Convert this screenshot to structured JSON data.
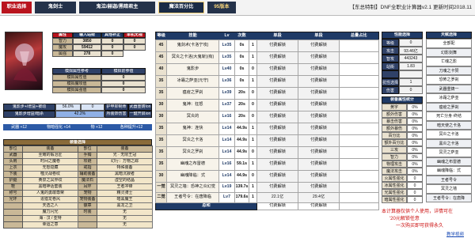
{
  "topbar": {
    "tabs": [
      "职业选择",
      "鬼剑士",
      "鬼泣/赫迦/黑暗君主",
      "魔法百分比",
      "95版本"
    ],
    "banner": "【东总特制】DNF全职业计算器v2.1 更新时间2018.11"
  },
  "attrs": {
    "headers": [
      "属性",
      "输入站街",
      "其他补正",
      "单机无视"
    ],
    "rows": [
      {
        "name": "智力",
        "val": "3850",
        "other": "0",
        "ignore": "0"
      },
      {
        "name": "魔攻",
        "val": "59412",
        "other": "0",
        "ignore": "0"
      },
      {
        "name": "属强",
        "val": "278",
        "other": "0",
        "ignore": ""
      }
    ]
  },
  "simulate": {
    "rows": [
      {
        "label": "模拟属性参考",
        "value": "模拟前参值"
      },
      {
        "label": "模拟属性值",
        "value": "0"
      },
      {
        "label": "模拟魔攻值",
        "value": "0"
      },
      {
        "label": "模拟属强值",
        "value": "0"
      }
    ]
  },
  "buffs": {
    "row1": {
      "a": "鬼影步+/增益+被动",
      "b": "56.0%",
      "c": "0",
      "d": "护甲抑制命",
      "e": "武器重铸Ion"
    },
    "row2": {
      "a": "鬼影步增益/暗杀",
      "b": "42.2%",
      "d": "所装饰伤害",
      "e": "一鍵开启ion"
    },
    "row3": [
      "武器 +12",
      "物暗强化 +14",
      "物 +12",
      "各种提升+12"
    ]
  },
  "equip": {
    "title": "装备选择",
    "headers": [
      "部位",
      "装备",
      "部位",
      "装备"
    ],
    "rows": [
      [
        "",
        "无畏混战衣",
        "部位",
        "黑洞漫步装备3件"
      ],
      [
        "武器",
        "圣耀的锻冶匠",
        "手镯",
        "光 · 无限王冠"
      ],
      [
        "头肩",
        "时间之魔卷",
        "项链",
        "幻行：万物之踪"
      ],
      [
        "上衣",
        "无怒隐藏",
        "戒指",
        "特殊装备"
      ],
      [
        "下装",
        "噬灵战卷纹",
        "辅助装备",
        "黑暗沉寂者"
      ],
      [
        "护腿",
        "黄泉之冥界纹",
        "魔法石",
        "虚空的结晶"
      ],
      [
        "鞋",
        "黑暗神话套装",
        "耳环",
        "王者冲锋"
      ],
      [
        "称号",
        "人鬼的勇敢尊荣",
        "宠物",
        "精灵骑士"
      ],
      [
        "光环",
        "追猎龙卷风",
        "宠物装备",
        "暗黑魔王"
      ],
      [
        "",
        "天选之人",
        "徽章",
        "黑龙之卫"
      ],
      [
        "",
        "魔力闪光",
        "时装",
        "无"
      ],
      [
        "",
        "海 · 汉 / 亚特",
        "",
        "无"
      ],
      [
        "",
        "幸运之意",
        "",
        "无"
      ]
    ]
  },
  "skills": {
    "headers": [
      "等级",
      "技能",
      "Lv",
      "次数",
      "",
      "单段",
      "单段",
      "总量占比"
    ],
    "rows": [
      {
        "lvl": "45",
        "name": "鬼剑术(卡洛宁攻)",
        "lv": "Lv35",
        "n": "0s",
        "cnt": "1",
        "a": "付费解锁",
        "b": "付费解锁"
      },
      {
        "lvl": "45",
        "name": "冥炎之卡洛(大鬼斩)(有)",
        "lv": "Lv35",
        "n": "0s",
        "cnt": "1",
        "a": "付费解锁",
        "b": "付费解锁"
      },
      {
        "lvl": "40",
        "name": "鬼影步",
        "lv": "Lv40",
        "n": "0s",
        "cnt": "0",
        "a": "付费解锁",
        "b": "付费解锁"
      },
      {
        "lvl": "35",
        "name": "冰霜之萨亚(元守)",
        "lv": "Lv36",
        "n": "0s",
        "cnt": "1",
        "a": "付费解锁",
        "b": "付费解锁"
      },
      {
        "lvl": "35",
        "name": "瘟疫之罗刹",
        "lv": "Lv39",
        "n": "20s",
        "cnt": "0",
        "a": "付费解锁",
        "b": "付费解锁"
      },
      {
        "lvl": "30",
        "name": "鬼神：狂怒",
        "lv": "Lv37",
        "n": "20s",
        "cnt": "0",
        "a": "付费解锁",
        "b": "付费解锁"
      },
      {
        "lvl": "30",
        "name": "冥炎的",
        "lv": "Lv16",
        "n": "20s",
        "cnt": "0",
        "a": "付费解锁",
        "b": "付费解锁"
      },
      {
        "lvl": "35",
        "name": "鬼神：连快",
        "lv": "Lv14",
        "n": "44.9s",
        "cnt": "1",
        "a": "付费解锁",
        "b": "付费解锁"
      },
      {
        "lvl": "35",
        "name": "冥炎之卡洛",
        "lv": "Lv14",
        "n": "44.9s",
        "cnt": "1",
        "a": "付费解锁",
        "b": "付费解锁"
      },
      {
        "lvl": "35",
        "name": "冥炎之罗刹",
        "lv": "Lv14",
        "n": "44.9s",
        "cnt": "0",
        "a": "付费解锁",
        "b": "付费解锁"
      },
      {
        "lvl": "35",
        "name": "幽魂之布雷德",
        "lv": "Lv16",
        "n": "59.1s",
        "cnt": "1",
        "a": "付费解锁",
        "b": "付费解锁"
      },
      {
        "lvl": "30",
        "name": "幽魂降临：式",
        "lv": "Lv14",
        "n": "44.9s",
        "cnt": "0",
        "a": "付费解锁",
        "b": "付费解锁"
      }
    ],
    "special": [
      {
        "lvl": "一觉",
        "name": "冥灵之墙：恐神之炎幻觉",
        "lv": "Lv19",
        "n": "139.7s",
        "cnt": "1",
        "a": "付费解锁",
        "b": "付费解锁"
      },
      {
        "lvl": "二觉",
        "name": "王者号令：在唐降临",
        "lv": "Lv7",
        "n": "179.6s",
        "cnt": "1",
        "a": "22.1亿",
        "b": "29.4亿"
      }
    ],
    "total_label": "总和",
    "total_a": "付费解锁",
    "total_b": "付费解锁"
  },
  "rightStats": {
    "title": "性能选择",
    "rows": [
      {
        "k": "等级",
        "v": "0"
      },
      {
        "k": "攻击",
        "v": "93.46亿"
      },
      {
        "k": "智攻",
        "v": "443243"
      },
      {
        "k": "站街",
        "v": "1.83"
      },
      {
        "k": "",
        "v": ""
      },
      {
        "k": "抗性选择",
        "v": "1"
      },
      {
        "k": "伤害",
        "v": "0"
      }
    ],
    "addTitle": "装备属性统计",
    "addRows": [
      [
        "黄字",
        "0%"
      ],
      [
        "额外伤害",
        "0%"
      ],
      [
        "暴击伤害",
        "0%"
      ],
      [
        "额外暴伤",
        "0%"
      ],
      [
        "百分比",
        "0%"
      ],
      [
        "额外百分比",
        "0%"
      ],
      [
        "三攻",
        "0%"
      ],
      [
        "智力",
        "0%"
      ],
      [
        "物理攻击",
        "0%"
      ],
      [
        "魔法攻击",
        "0%"
      ],
      [
        "火属性强化",
        "0"
      ],
      [
        "冰属性强化",
        "0"
      ],
      [
        "光属性强化",
        "0"
      ],
      [
        "暗属性强化",
        "0"
      ]
    ]
  },
  "rightmost": {
    "title": "天赋选择",
    "items": [
      "全部配",
      "幻影剑舞",
      "亡魂之影",
      "刀魂之卡赞",
      "恐怖之罗刹",
      "武器重铸一",
      "冰霜之萨亚",
      "瘟疫之罗刹",
      "死亡分身·终结",
      "暗天使之卡洛",
      "冥炎之卡洛",
      "黑炎之卡洛",
      "冥灵之萨亚",
      "幽魂之布雷德",
      "幽魂降临：式",
      "王者号令",
      "冥灵之墙",
      "王者号令：在唐降"
    ]
  },
  "notice": {
    "l1": "本计算器仅供个人使用，详情可在",
    "l2": "'20元解锁任意",
    "l3": "一次购买即可获得永久",
    "link": "教学视频"
  },
  "colors": {
    "navy": "#1f3a66",
    "red": "#b8141d",
    "tan": "#c9b897",
    "blue": "#2c5aa6",
    "gold": "#f5d37a"
  }
}
